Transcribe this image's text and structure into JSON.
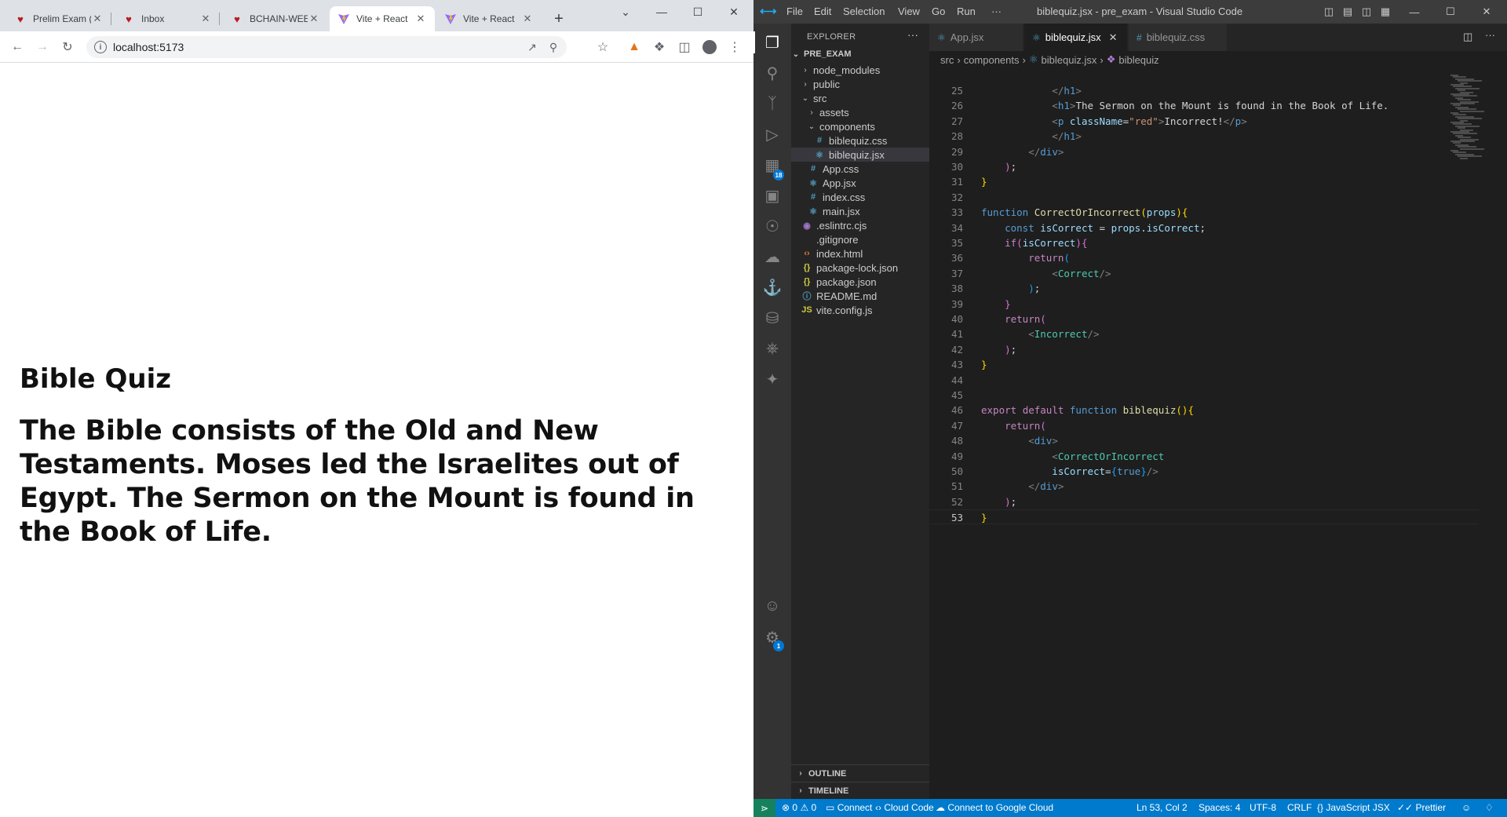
{
  "chrome": {
    "tabs": [
      {
        "title": "Prelim Exam (",
        "favicon": "red-logo",
        "active": false
      },
      {
        "title": "Inbox",
        "favicon": "red-logo",
        "active": false
      },
      {
        "title": "BCHAIN-WEE",
        "favicon": "red-logo",
        "active": false
      },
      {
        "title": "Vite + React",
        "favicon": "vite-logo",
        "active": true
      },
      {
        "title": "Vite + React",
        "favicon": "vite-logo",
        "active": false
      }
    ],
    "url": "localhost:5173",
    "page": {
      "title": "Bible Quiz",
      "body": "The Bible consists of the Old and New Testaments. Moses led the Israelites out of Egypt. The Sermon on the Mount is found in the Book of Life."
    }
  },
  "vscode": {
    "window_title": "biblequiz.jsx - pre_exam - Visual Studio Code",
    "menu": [
      "File",
      "Edit",
      "Selection",
      "View",
      "Go",
      "Run",
      "···"
    ],
    "explorer": {
      "header": "EXPLORER",
      "root": "PRE_EXAM",
      "items": [
        {
          "label": "node_modules",
          "kind": "folder-closed",
          "depth": 1
        },
        {
          "label": "public",
          "kind": "folder-closed",
          "depth": 1
        },
        {
          "label": "src",
          "kind": "folder-open",
          "depth": 1
        },
        {
          "label": "assets",
          "kind": "folder-closed",
          "depth": 2
        },
        {
          "label": "components",
          "kind": "folder-open",
          "depth": 2
        },
        {
          "label": "biblequiz.css",
          "kind": "css",
          "depth": 3
        },
        {
          "label": "biblequiz.jsx",
          "kind": "jsx",
          "depth": 3,
          "selected": true
        },
        {
          "label": "App.css",
          "kind": "css",
          "depth": 2
        },
        {
          "label": "App.jsx",
          "kind": "jsx",
          "depth": 2
        },
        {
          "label": "index.css",
          "kind": "css",
          "depth": 2
        },
        {
          "label": "main.jsx",
          "kind": "jsx",
          "depth": 2
        },
        {
          "label": ".eslintrc.cjs",
          "kind": "eslint",
          "depth": 1
        },
        {
          "label": ".gitignore",
          "kind": "git",
          "depth": 1
        },
        {
          "label": "index.html",
          "kind": "html",
          "depth": 1
        },
        {
          "label": "package-lock.json",
          "kind": "json",
          "depth": 1
        },
        {
          "label": "package.json",
          "kind": "json",
          "depth": 1
        },
        {
          "label": "README.md",
          "kind": "info",
          "depth": 1
        },
        {
          "label": "vite.config.js",
          "kind": "js",
          "depth": 1
        }
      ],
      "outline": "OUTLINE",
      "timeline": "TIMELINE"
    },
    "editor_tabs": [
      {
        "label": "App.jsx",
        "icon": "react-icon",
        "active": false
      },
      {
        "label": "biblequiz.jsx",
        "icon": "react-icon",
        "active": true
      },
      {
        "label": "biblequiz.css",
        "icon": "css-icon",
        "active": false
      }
    ],
    "breadcrumb": [
      "src",
      "components",
      "biblequiz.jsx",
      "biblequiz"
    ],
    "code_lines": [
      {
        "n": "25",
        "tokens": [
          [
            "t-tag",
            "            </"
          ],
          [
            "t-el",
            "h1"
          ],
          [
            "t-tag",
            ">"
          ]
        ]
      },
      {
        "n": "26",
        "tokens": [
          [
            "t-tag",
            "            <"
          ],
          [
            "t-el",
            "h1"
          ],
          [
            "t-tag",
            ">"
          ],
          [
            "t-txt",
            "The Sermon on the Mount is found in the Book of Life."
          ]
        ]
      },
      {
        "n": "27",
        "tokens": [
          [
            "t-tag",
            "            <"
          ],
          [
            "t-el",
            "p"
          ],
          [
            "t-var",
            " className"
          ],
          [
            "t-txt",
            "="
          ],
          [
            "t-str",
            "\"red\""
          ],
          [
            "t-tag",
            ">"
          ],
          [
            "t-txt",
            "Incorrect!"
          ],
          [
            "t-tag",
            "</"
          ],
          [
            "t-el",
            "p"
          ],
          [
            "t-tag",
            ">"
          ]
        ]
      },
      {
        "n": "28",
        "tokens": [
          [
            "t-tag",
            "            </"
          ],
          [
            "t-el",
            "h1"
          ],
          [
            "t-tag",
            ">"
          ]
        ]
      },
      {
        "n": "29",
        "tokens": [
          [
            "t-tag",
            "        </"
          ],
          [
            "t-el",
            "div"
          ],
          [
            "t-tag",
            ">"
          ]
        ]
      },
      {
        "n": "30",
        "tokens": [
          [
            "t-br2",
            "    )"
          ],
          [
            "t-txt",
            ";"
          ]
        ]
      },
      {
        "n": "31",
        "tokens": [
          [
            "t-br1",
            "}"
          ]
        ]
      },
      {
        "n": "32",
        "tokens": []
      },
      {
        "n": "33",
        "tokens": [
          [
            "t-kw",
            "function "
          ],
          [
            "t-fn",
            "CorrectOrIncorrect"
          ],
          [
            "t-br1",
            "("
          ],
          [
            "t-var",
            "props"
          ],
          [
            "t-br1",
            ")"
          ],
          [
            "t-br1",
            "{"
          ]
        ]
      },
      {
        "n": "34",
        "tokens": [
          [
            "t-kw",
            "    const "
          ],
          [
            "t-var",
            "isCorrect"
          ],
          [
            "t-txt",
            " = "
          ],
          [
            "t-var",
            "props"
          ],
          [
            "t-txt",
            "."
          ],
          [
            "t-var",
            "isCorrect"
          ],
          [
            "t-txt",
            ";"
          ]
        ]
      },
      {
        "n": "35",
        "tokens": [
          [
            "t-ctl",
            "    if"
          ],
          [
            "t-br2",
            "("
          ],
          [
            "t-var",
            "isCorrect"
          ],
          [
            "t-br2",
            ")"
          ],
          [
            "t-br2",
            "{"
          ]
        ]
      },
      {
        "n": "36",
        "tokens": [
          [
            "t-ctl",
            "        return"
          ],
          [
            "t-br3",
            "("
          ]
        ]
      },
      {
        "n": "37",
        "tokens": [
          [
            "t-tag",
            "            <"
          ],
          [
            "t-comp",
            "Correct"
          ],
          [
            "t-tag",
            "/>"
          ]
        ]
      },
      {
        "n": "38",
        "tokens": [
          [
            "t-br3",
            "        )"
          ],
          [
            "t-txt",
            ";"
          ]
        ]
      },
      {
        "n": "39",
        "tokens": [
          [
            "t-br2",
            "    }"
          ]
        ]
      },
      {
        "n": "40",
        "tokens": [
          [
            "t-ctl",
            "    return"
          ],
          [
            "t-br2",
            "("
          ]
        ]
      },
      {
        "n": "41",
        "tokens": [
          [
            "t-tag",
            "        <"
          ],
          [
            "t-comp",
            "Incorrect"
          ],
          [
            "t-tag",
            "/>"
          ]
        ]
      },
      {
        "n": "42",
        "tokens": [
          [
            "t-br2",
            "    )"
          ],
          [
            "t-txt",
            ";"
          ]
        ]
      },
      {
        "n": "43",
        "tokens": [
          [
            "t-br1",
            "}"
          ]
        ]
      },
      {
        "n": "44",
        "tokens": []
      },
      {
        "n": "45",
        "tokens": []
      },
      {
        "n": "46",
        "tokens": [
          [
            "t-ctl",
            "export "
          ],
          [
            "t-ctl",
            "default "
          ],
          [
            "t-kw",
            "function "
          ],
          [
            "t-fn",
            "biblequiz"
          ],
          [
            "t-br1",
            "()"
          ],
          [
            "t-br1",
            "{"
          ]
        ]
      },
      {
        "n": "47",
        "tokens": [
          [
            "t-ctl",
            "    return"
          ],
          [
            "t-br2",
            "("
          ]
        ]
      },
      {
        "n": "48",
        "tokens": [
          [
            "t-tag",
            "        <"
          ],
          [
            "t-el",
            "div"
          ],
          [
            "t-tag",
            ">"
          ]
        ]
      },
      {
        "n": "49",
        "tokens": [
          [
            "t-tag",
            "            <"
          ],
          [
            "t-comp",
            "CorrectOrIncorrect"
          ]
        ]
      },
      {
        "n": "50",
        "tokens": [
          [
            "t-var",
            "            isCorrect"
          ],
          [
            "t-txt",
            "="
          ],
          [
            "t-br3",
            "{"
          ],
          [
            "t-kw",
            "true"
          ],
          [
            "t-br3",
            "}"
          ],
          [
            "t-tag",
            "/>"
          ]
        ]
      },
      {
        "n": "51",
        "tokens": [
          [
            "t-tag",
            "        </"
          ],
          [
            "t-el",
            "div"
          ],
          [
            "t-tag",
            ">"
          ]
        ]
      },
      {
        "n": "52",
        "tokens": [
          [
            "t-br2",
            "    )"
          ],
          [
            "t-txt",
            ";"
          ]
        ]
      },
      {
        "n": "53",
        "tokens": [
          [
            "t-br1",
            "}"
          ]
        ],
        "current": true
      }
    ],
    "status": {
      "errors": "0",
      "warnings": "0",
      "connect": "Connect",
      "cloud_code": "Cloud Code",
      "google_cloud": "Connect to Google Cloud",
      "position": "Ln 53, Col 2",
      "spaces": "Spaces: 4",
      "encoding": "UTF-8",
      "eol": "CRLF",
      "language": "JavaScript JSX",
      "prettier": "Prettier"
    },
    "badges": {
      "extensions": "18",
      "settings": "1"
    }
  }
}
